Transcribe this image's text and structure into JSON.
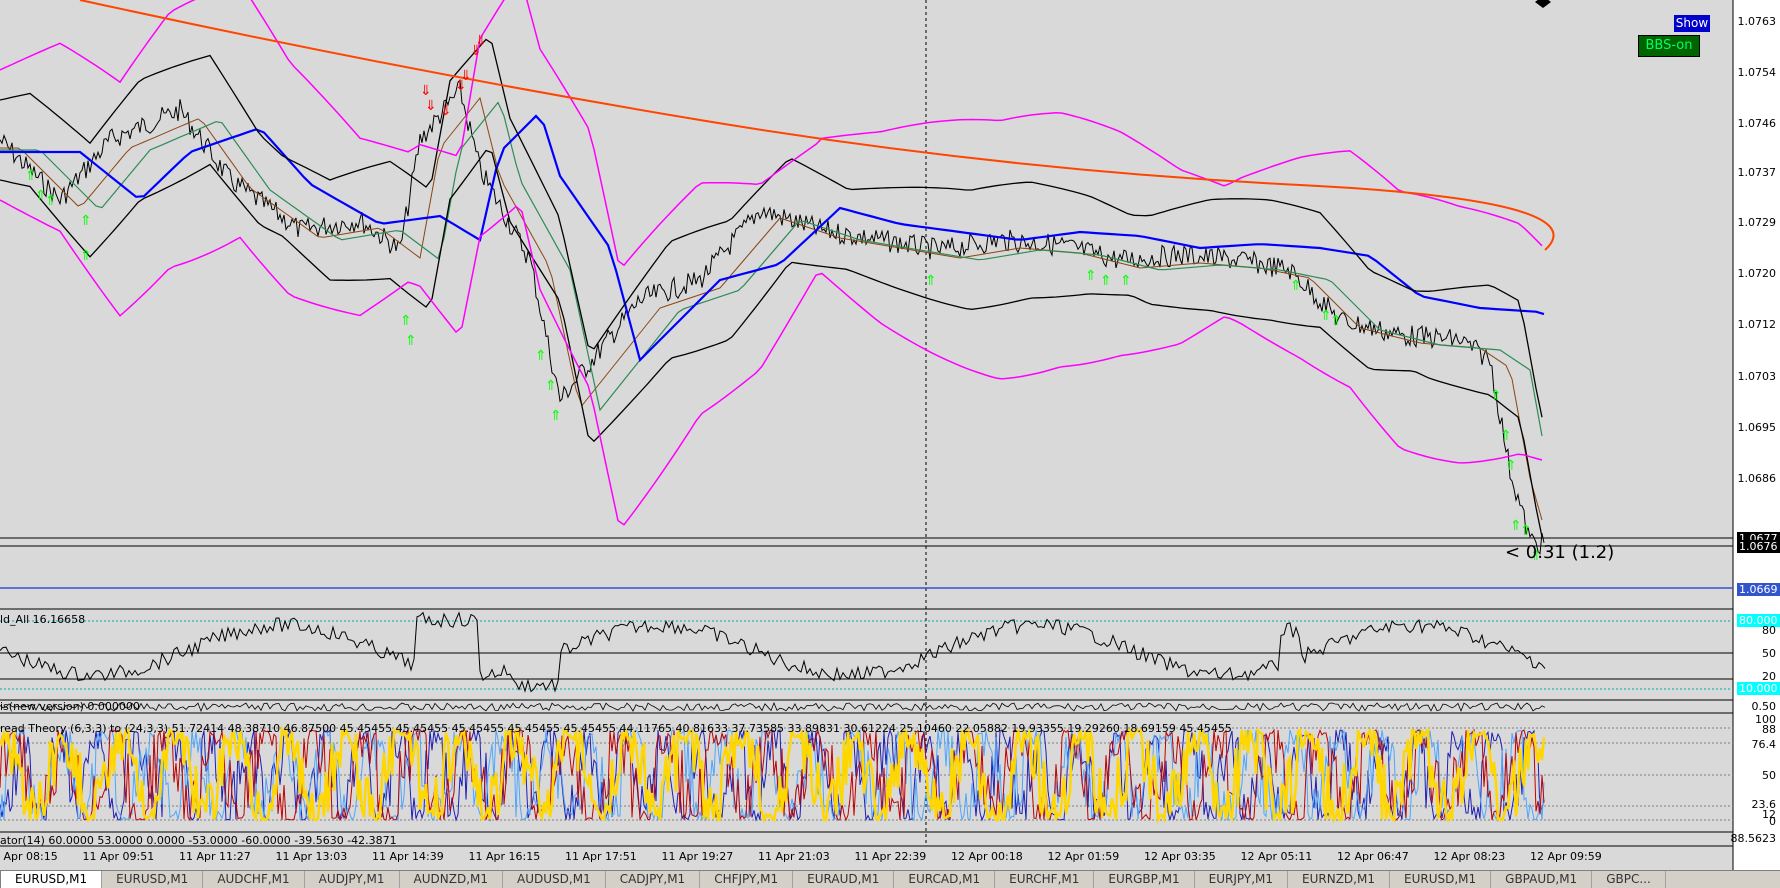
{
  "price_axis": [
    "1.0763",
    "1.0754",
    "1.0746",
    "1.0737",
    "1.0729",
    "1.0720",
    "1.0712",
    "1.0703",
    "1.0695",
    "1.0686"
  ],
  "price_tags": {
    "bid": "1.0677",
    "ask": "1.0676",
    "line": "1.0669",
    "level_high": "80.000",
    "level_low": "10.000"
  },
  "sub1_axis": [
    "80",
    "50",
    "20"
  ],
  "sub2_axis": [
    "0.50"
  ],
  "sub3_axis": [
    "100",
    "88",
    "76.4",
    "50",
    "23.6",
    "12",
    "0"
  ],
  "sub4_axis": [
    "88.5623"
  ],
  "time_axis": [
    "11 Apr 08:15",
    "11 Apr 09:51",
    "11 Apr 11:27",
    "11 Apr 13:03",
    "11 Apr 14:39",
    "11 Apr 16:15",
    "11 Apr 17:51",
    "11 Apr 19:27",
    "11 Apr 21:03",
    "11 Apr 22:39",
    "12 Apr 00:18",
    "12 Apr 01:59",
    "12 Apr 03:35",
    "12 Apr 05:11",
    "12 Apr 06:47",
    "12 Apr 08:23",
    "12 Apr 09:59"
  ],
  "buttons": {
    "show": "Show",
    "bbs": "BBS-on"
  },
  "annotation": "< 0.31 (1.2)",
  "indicator_labels": {
    "sub1": "ld_All 16.16658",
    "sub2": "is(new version) 0.000000",
    "sub3": "read Theory (6,3,3) to (24,3,3) 51.72414 48.38710 46.87500 45.45455 45.45455 45.45455 45.45455 45.45455 44.11765 40.81633 37.73585 33.89831 30.61224 25.10460 22.05882 19.93355 19.29260 18.69159 45.45455",
    "sub4": "ator(14) 60.0000 53.0000 0.0000 -53.0000 -60.0000 -39.5630 -42.3871"
  },
  "tabs": [
    "EURUSD,M1",
    "EURUSD,M1",
    "AUDCHF,M1",
    "AUDJPY,M1",
    "AUDNZD,M1",
    "AUDUSD,M1",
    "CADJPY,M1",
    "CHFJPY,M1",
    "EURAUD,M1",
    "EURCAD,M1",
    "EURCHF,M1",
    "EURGBP,M1",
    "EURJPY,M1",
    "EURNZD,M1",
    "EURUSD,M1",
    "GBPAUD,M1",
    "GBPC..."
  ],
  "colors": {
    "background": "#d9d9d9",
    "price_line": "#000000",
    "bollinger": "#ff00ff",
    "ma_long": "#ff4500",
    "ma_blue": "#0000ff",
    "ma_green": "#2e8b57",
    "ma_brown": "#8b4513",
    "arrow_up": "#00ff00",
    "arrow_down": "#ff0000",
    "osc_yellow": "#ffd700",
    "osc_blue": "#1e1eb4",
    "osc_red": "#c00000",
    "osc_light": "#4da6ff"
  }
}
